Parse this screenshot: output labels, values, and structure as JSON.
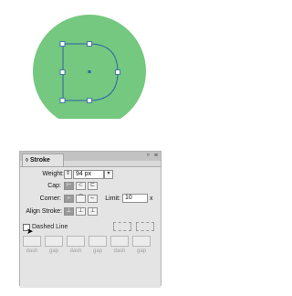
{
  "colors": {
    "circle_fill": "#74c87f",
    "selection": "#2f5fa8",
    "panel_bg": "#e4e4e4"
  },
  "stroke_panel": {
    "tab_label": "Stroke",
    "weight_label": "Weight:",
    "weight_value": "94 px",
    "cap_label": "Cap:",
    "corner_label": "Corner:",
    "limit_label": "Limit:",
    "limit_value": "10",
    "limit_unit": "x",
    "align_label": "Align Stroke:",
    "dashed_label": "Dashed Line",
    "dashed_checked": false,
    "dash_fields": [
      "dash",
      "gap",
      "dash",
      "gap",
      "dash",
      "gap"
    ]
  }
}
